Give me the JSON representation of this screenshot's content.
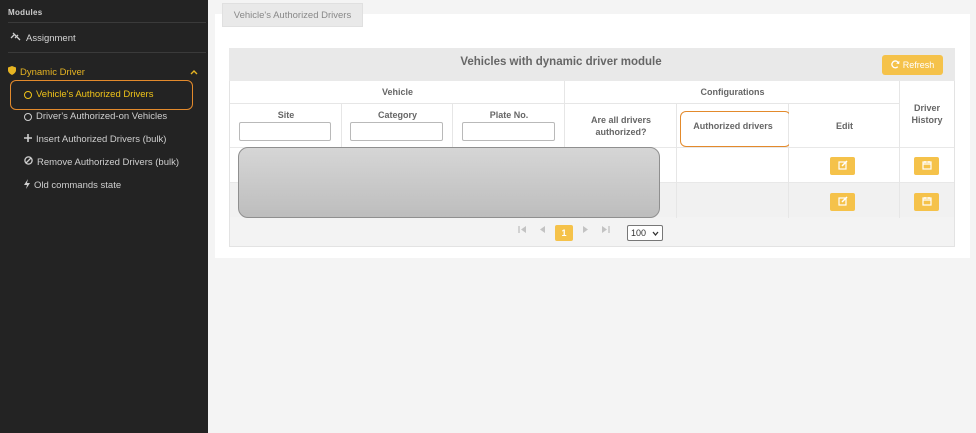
{
  "sidebar": {
    "heading": "Modules",
    "assignment_label": "Assignment",
    "group_label": "Dynamic Driver",
    "items": [
      {
        "label": "Vehicle's Authorized Drivers"
      },
      {
        "label": "Driver's Authorized-on Vehicles"
      },
      {
        "label": "Insert Authorized Drivers (bulk)"
      },
      {
        "label": "Remove Authorized Drivers (bulk)"
      },
      {
        "label": "Old commands state"
      }
    ]
  },
  "tab": {
    "label": "Vehicle's Authorized Drivers"
  },
  "table": {
    "title": "Vehicles with dynamic driver module",
    "refresh_label": "Refresh",
    "group_headers": {
      "vehicle": "Vehicle",
      "configurations": "Configurations"
    },
    "columns": {
      "site": "Site",
      "category": "Category",
      "plate": "Plate No.",
      "all_authorized": "Are all drivers authorized?",
      "authorized_drivers": "Authorized drivers",
      "edit": "Edit",
      "history": "Driver History"
    }
  },
  "pagination": {
    "current_page": "1",
    "page_size": "100"
  },
  "colors": {
    "accent": "#f5c24a",
    "highlight": "#e38a2c",
    "sidebar_bg": "#232323"
  }
}
